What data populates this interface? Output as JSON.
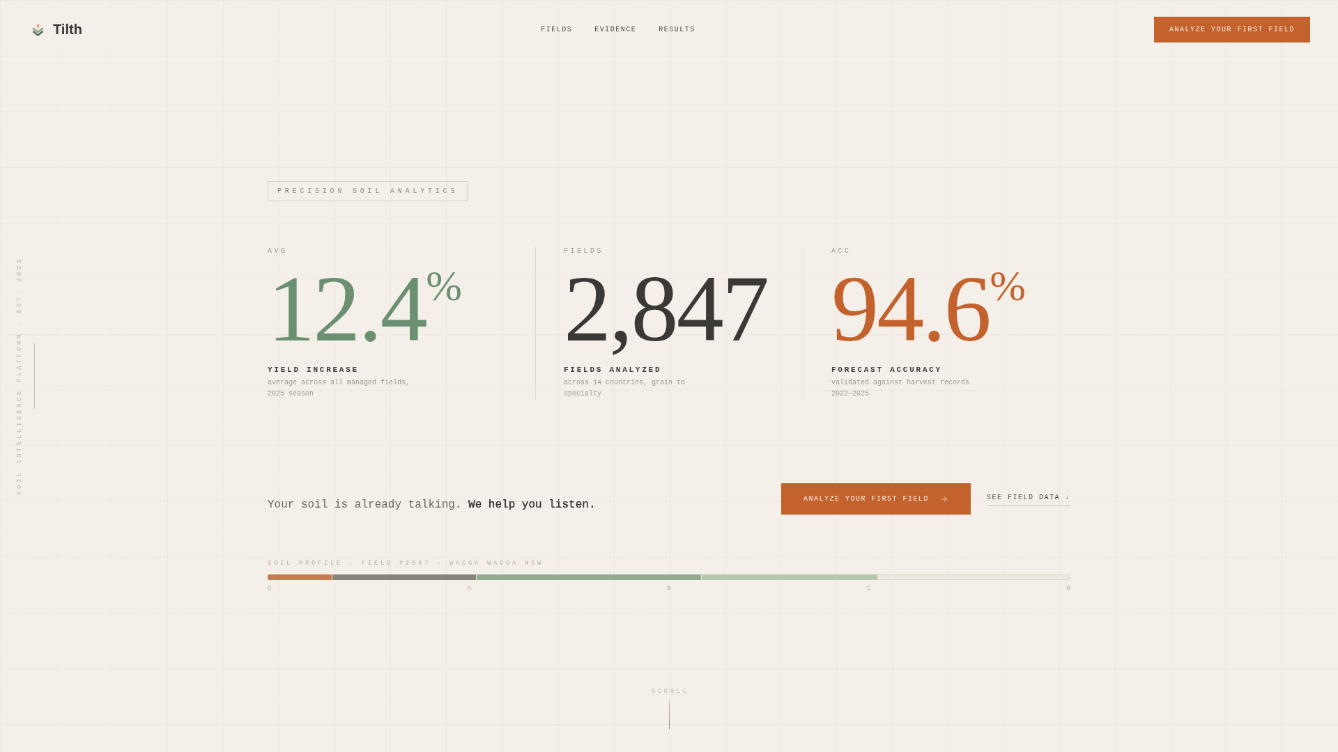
{
  "header": {
    "logo": {
      "name": "Tilth"
    },
    "nav": [
      {
        "label": "FIELDS"
      },
      {
        "label": "EVIDENCE"
      },
      {
        "label": "RESULTS"
      }
    ],
    "cta": "ANALYZE YOUR FIRST FIELD"
  },
  "side_caption": "SOIL INTELLIGENCE PLATFORM · EST. 2021",
  "hero": {
    "tag": "PRECISION SOIL ANALYTICS",
    "stats": [
      {
        "label": "AVG",
        "value": "12.4",
        "unit": "%",
        "color": "#6b8f71",
        "title": "YIELD INCREASE",
        "description": "average across all managed fields, 2025 season"
      },
      {
        "label": "FIELDS",
        "value": "2,847",
        "color": "#3a3935",
        "title": "FIELDS ANALYZED",
        "description": "across 14 countries, grain to specialty"
      },
      {
        "label": "ACC",
        "value": "94.6",
        "unit": "%",
        "color": "#c4622d",
        "title": "FORECAST ACCURACY",
        "description": "validated against harvest records 2022–2025"
      }
    ],
    "tagline": "Your soil is already talking. **We help you listen.**",
    "primary_button": "ANALYZE YOUR FIRST FIELD",
    "secondary_link": "SEE FIELD DATA ↓"
  },
  "soil_profile": {
    "title": "SOIL PROFILE · FIELD #2847 · WAGGA WAGGA NSW",
    "horizons": [
      "O",
      "A",
      "B",
      "C",
      "R"
    ]
  },
  "scroll_hint": "SCROLL"
}
